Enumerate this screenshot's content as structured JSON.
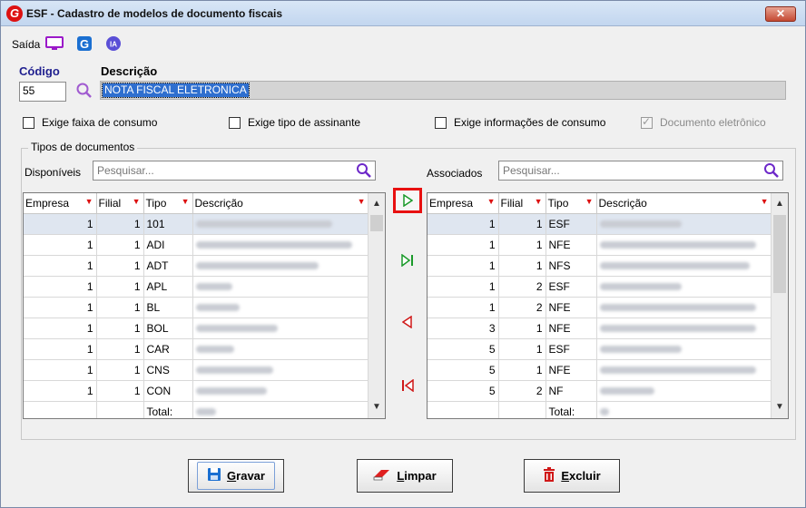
{
  "window": {
    "title": "ESF - Cadastro de modelos de documento fiscais",
    "close_glyph": "✕"
  },
  "toolbar": {
    "saida_label": "Saída",
    "ia_label": "IA"
  },
  "form": {
    "codigo_label": "Código",
    "descricao_label": "Descrição",
    "codigo_value": "55",
    "descricao_value": "NOTA FISCAL ELETRONICA"
  },
  "checkboxes": [
    {
      "label": "Exige faixa de consumo",
      "checked": false,
      "enabled": true
    },
    {
      "label": "Exige tipo de assinante",
      "checked": false,
      "enabled": true
    },
    {
      "label": "Exige informações de consumo",
      "checked": false,
      "enabled": true
    },
    {
      "label": "Documento eletrônico",
      "checked": true,
      "enabled": false
    }
  ],
  "group": {
    "title": "Tipos de documentos"
  },
  "disponiveis": {
    "label": "Disponíveis",
    "placeholder": "Pesquisar...",
    "columns": [
      "Empresa",
      "Filial",
      "Tipo",
      "Descrição"
    ],
    "rows": [
      {
        "empresa": "1",
        "filial": "1",
        "tipo": "101"
      },
      {
        "empresa": "1",
        "filial": "1",
        "tipo": "ADI"
      },
      {
        "empresa": "1",
        "filial": "1",
        "tipo": "ADT"
      },
      {
        "empresa": "1",
        "filial": "1",
        "tipo": "APL"
      },
      {
        "empresa": "1",
        "filial": "1",
        "tipo": "BL"
      },
      {
        "empresa": "1",
        "filial": "1",
        "tipo": "BOL"
      },
      {
        "empresa": "1",
        "filial": "1",
        "tipo": "CAR"
      },
      {
        "empresa": "1",
        "filial": "1",
        "tipo": "CNS"
      },
      {
        "empresa": "1",
        "filial": "1",
        "tipo": "CON"
      }
    ],
    "total_label": "Total:"
  },
  "associados": {
    "label": "Associados",
    "placeholder": "Pesquisar...",
    "columns": [
      "Empresa",
      "Filial",
      "Tipo",
      "Descrição"
    ],
    "rows": [
      {
        "empresa": "1",
        "filial": "1",
        "tipo": "ESF"
      },
      {
        "empresa": "1",
        "filial": "1",
        "tipo": "NFE"
      },
      {
        "empresa": "1",
        "filial": "1",
        "tipo": "NFS"
      },
      {
        "empresa": "1",
        "filial": "2",
        "tipo": "ESF"
      },
      {
        "empresa": "1",
        "filial": "2",
        "tipo": "NFE"
      },
      {
        "empresa": "3",
        "filial": "1",
        "tipo": "NFE"
      },
      {
        "empresa": "5",
        "filial": "1",
        "tipo": "ESF"
      },
      {
        "empresa": "5",
        "filial": "1",
        "tipo": "NFE"
      },
      {
        "empresa": "5",
        "filial": "2",
        "tipo": "NF"
      }
    ],
    "total_label": "Total:"
  },
  "buttons": {
    "gravar": {
      "first": "G",
      "rest": "ravar"
    },
    "limpar": {
      "first": "L",
      "rest": "impar"
    },
    "excluir": {
      "first": "E",
      "rest": "xcluir"
    }
  },
  "colors": {
    "accent_blue": "#1f1f8f",
    "filter_red": "#d11111",
    "selection_blue": "#2f6fcf",
    "focus_red": "#e81010",
    "transfer_green": "#1a9a2a",
    "transfer_red": "#d01818"
  }
}
